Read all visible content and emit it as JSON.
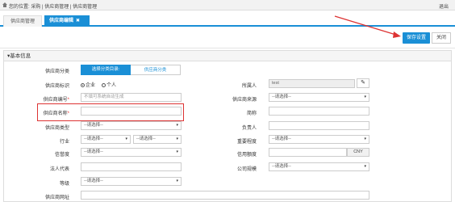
{
  "topbar": {
    "location": "您的位置: 采购 | 供应商管理 | 供应商管理",
    "exit": "退出"
  },
  "tabs": [
    {
      "label": "供应商管理"
    },
    {
      "label": "供应商编辑",
      "close": "✖"
    }
  ],
  "actions": {
    "save": "保存设置",
    "close": "关闭"
  },
  "section": {
    "title": "▾基本信息"
  },
  "form": {
    "category_label": "供应商分类",
    "category_tab_on": "选择分类目录:",
    "category_tab_off": "供应商分类",
    "identity_label": "供应商标识",
    "identity_company": "企业",
    "identity_person": "个人",
    "owner_label": "所属人",
    "owner_value": "test",
    "code_label": "供应商编号",
    "code_placeholder": "不填可系统自动生成",
    "source_label": "供应商来源",
    "name_label": "供应商名称",
    "abbr_label": "简称",
    "type_label": "供应商类型",
    "manager_label": "负责人",
    "industry_label": "行业",
    "importance_label": "重要程度",
    "credit_label": "信誉度",
    "credit_limit_label": "信用额度",
    "currency": "CNY",
    "legal_label": "法人代表",
    "scale_label": "公司规模",
    "level_label": "等级",
    "website_label": "供应商网址",
    "select_placeholder": "--请选择--"
  },
  "colors": {
    "accent": "#1a8fd6",
    "highlight": "#d33333"
  }
}
